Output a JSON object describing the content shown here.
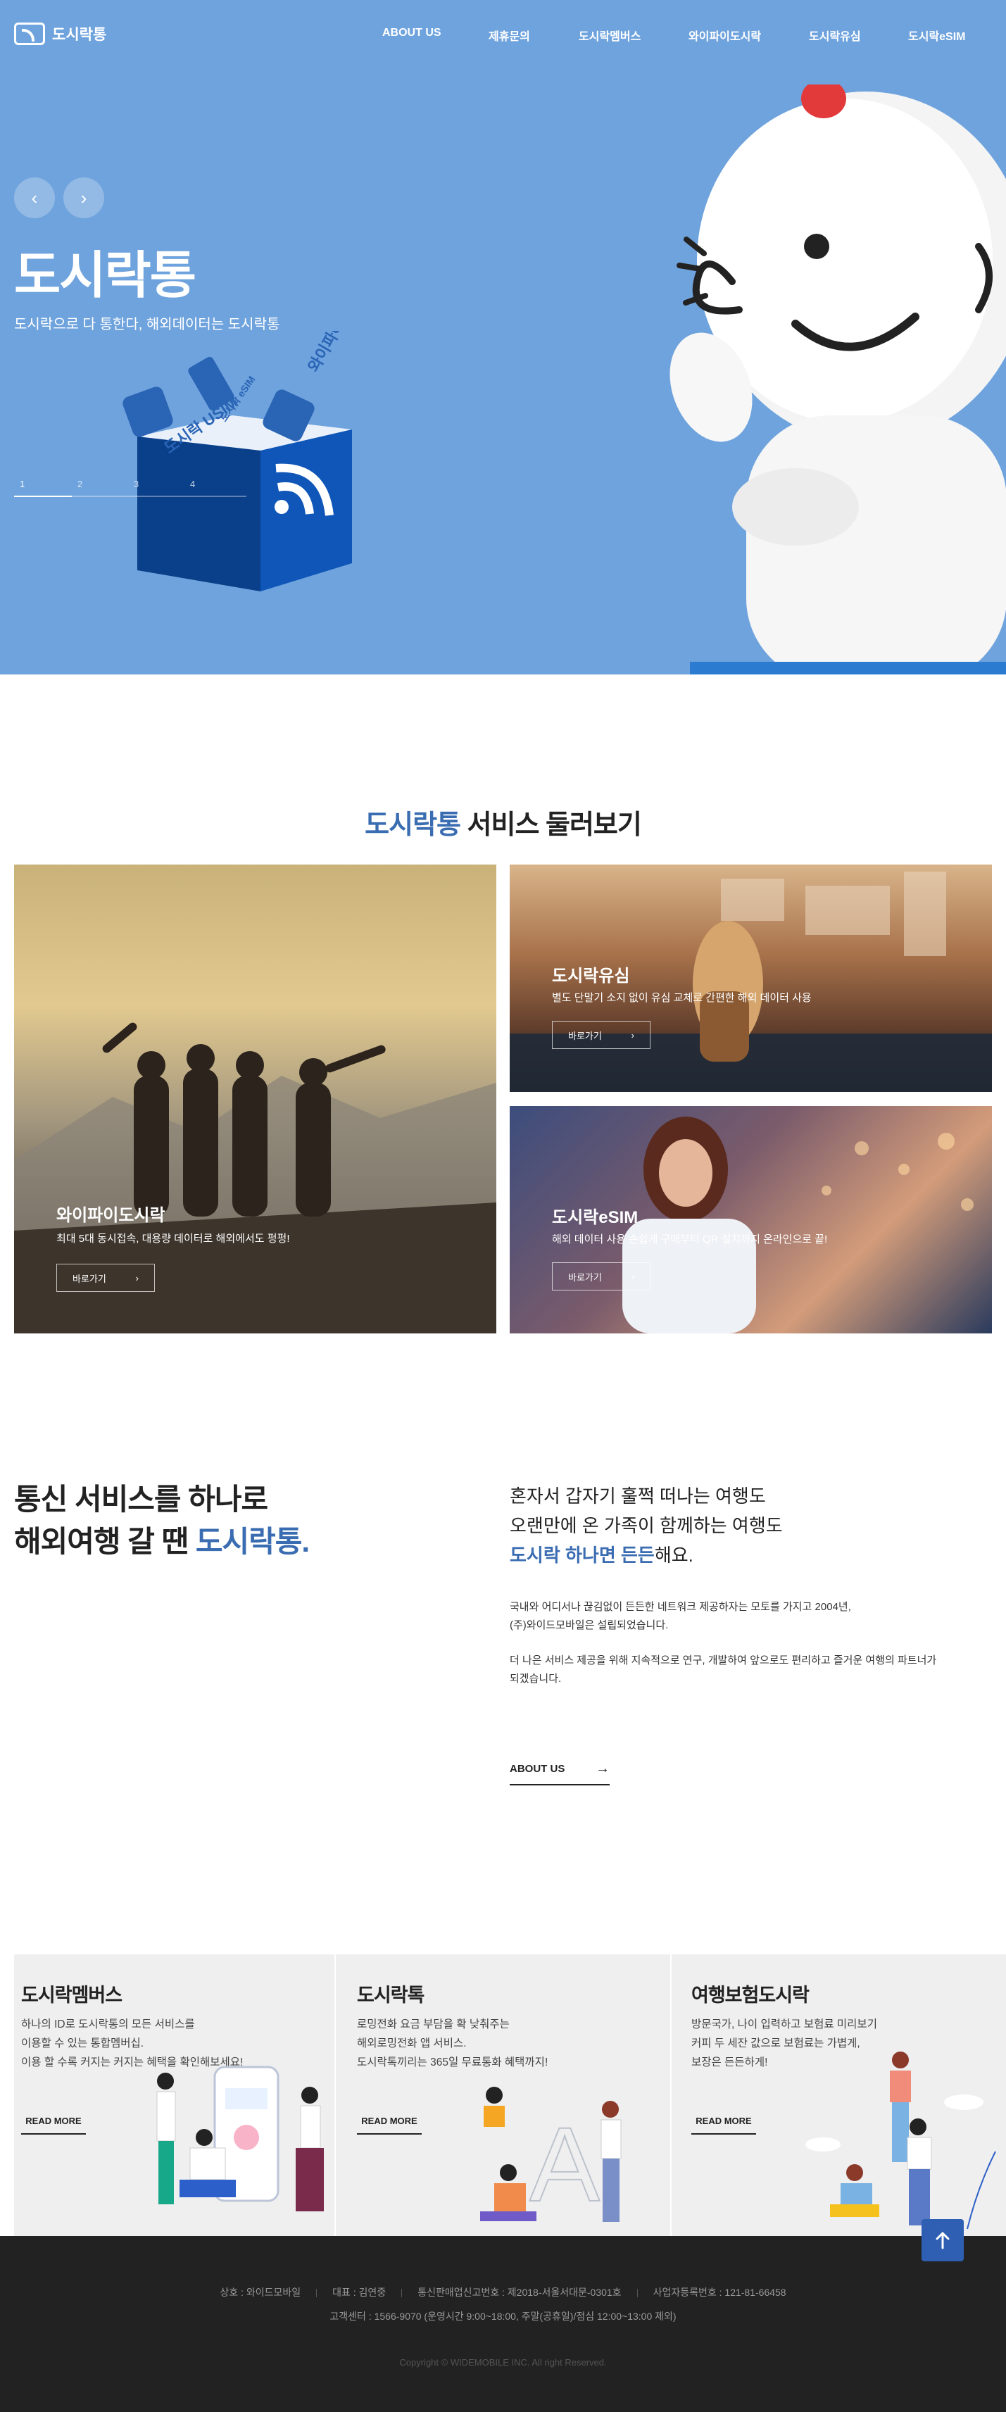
{
  "header": {
    "logo_text": "도시락통",
    "nav": [
      "ABOUT US",
      "제휴문의",
      "도시락멤버스",
      "와이파이도시락",
      "도시락유심",
      "도시락eSIM"
    ]
  },
  "hero": {
    "title": "도시락통",
    "subtitle": "도시락으로 다 통한다, 해외데이터는 도시락통",
    "prev_icon": "chevron-left-icon",
    "next_icon": "chevron-right-icon",
    "pager": [
      "1",
      "2",
      "3",
      "4"
    ],
    "active_page": 1,
    "box_labels": [
      "도시락 USIM",
      "도시락 eSIM",
      "와이파이 도시락"
    ],
    "bg_color": "#6fa3dd"
  },
  "services": {
    "title_accent": "도시락통",
    "title_rest": " 서비스 둘러보기",
    "cards": [
      {
        "title": "와이파이도시락",
        "desc": "최대 5대 동시접속, 대용량 데이터로 해외에서도 펑펑!",
        "button": "바로가기"
      },
      {
        "title": "도시락유심",
        "desc": "별도 단말기 소지 없이 유심 교체로 간편한 해외 데이터 사용",
        "button": "바로가기"
      },
      {
        "title": "도시락eSIM",
        "desc": "해외 데이터 사용 손쉽게 구매부터 QR 설치까지 온라인으로 끝!",
        "button": "바로가기"
      }
    ]
  },
  "about": {
    "heading_line1": "통신 서비스를 하나로",
    "heading_line2_prefix": "해외여행 갈 땐 ",
    "heading_line2_accent": "도시락통.",
    "lead_line1": "혼자서 갑자기 훌쩍 떠나는 여행도",
    "lead_line2": "오랜만에 온 가족이 함께하는 여행도",
    "lead_line3_accent": "도시락 하나면 든든",
    "lead_line3_rest": "해요.",
    "para1_line1": "국내와 어디서나 끊김없이 든든한 네트워크 제공하자는 모토를 가지고 2004년,",
    "para1_line2": "(주)와이드모바일은 설립되었습니다.",
    "para2_line1": "더 나은 서비스 제공을 위해 지속적으로 연구, 개발하여 앞으로도 편리하고 즐거운 여행의 파트너가",
    "para2_line2": "되겠습니다.",
    "button": "ABOUT US",
    "button_icon": "arrow-right-icon"
  },
  "promos": [
    {
      "title": "도시락멤버스",
      "lines": [
        "하나의 ID로 도시락통의 모든 서비스를",
        "이용할 수 있는 통합멤버십.",
        "이용 할 수록 커지는 커지는 혜택을 확인해보세요!"
      ],
      "button": "READ MORE"
    },
    {
      "title": "도시락톡",
      "lines": [
        "로밍전화 요금 부담을 확 낮춰주는",
        "해외로밍전화 앱 서비스.",
        "도시락톡끼리는 365일 무료통화 혜택까지!"
      ],
      "button": "READ MORE"
    },
    {
      "title": "여행보험도시락",
      "lines": [
        "방문국가, 나이 입력하고 보험료 미리보기",
        "커피 두 세잔 값으로 보험료는 가볍게,",
        "보장은 든든하게!"
      ],
      "button": "READ MORE"
    }
  ],
  "footer": {
    "row1": [
      "상호 : 와이드모바일",
      "대표 : 김연중",
      "통신판매업신고번호 : 제2018-서울서대문-0301호",
      "사업자등록번호 : 121-81-66458"
    ],
    "row2": "고객센터 : 1566-9070 (운영시간 9:00~18:00, 주말(공휴일)/점심 12:00~13:00 제외)",
    "copyright": "Copyright © WIDEMOBILE INC. All right Reserved.",
    "top_icon": "arrow-up-icon"
  }
}
